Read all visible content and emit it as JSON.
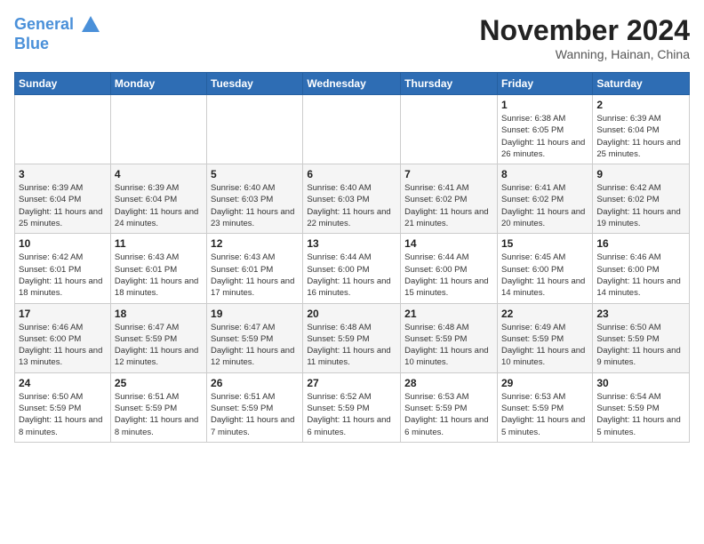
{
  "logo": {
    "line1": "General",
    "line2": "Blue"
  },
  "title": "November 2024",
  "subtitle": "Wanning, Hainan, China",
  "weekdays": [
    "Sunday",
    "Monday",
    "Tuesday",
    "Wednesday",
    "Thursday",
    "Friday",
    "Saturday"
  ],
  "weeks": [
    [
      {
        "day": "",
        "info": ""
      },
      {
        "day": "",
        "info": ""
      },
      {
        "day": "",
        "info": ""
      },
      {
        "day": "",
        "info": ""
      },
      {
        "day": "",
        "info": ""
      },
      {
        "day": "1",
        "info": "Sunrise: 6:38 AM\nSunset: 6:05 PM\nDaylight: 11 hours and 26 minutes."
      },
      {
        "day": "2",
        "info": "Sunrise: 6:39 AM\nSunset: 6:04 PM\nDaylight: 11 hours and 25 minutes."
      }
    ],
    [
      {
        "day": "3",
        "info": "Sunrise: 6:39 AM\nSunset: 6:04 PM\nDaylight: 11 hours and 25 minutes."
      },
      {
        "day": "4",
        "info": "Sunrise: 6:39 AM\nSunset: 6:04 PM\nDaylight: 11 hours and 24 minutes."
      },
      {
        "day": "5",
        "info": "Sunrise: 6:40 AM\nSunset: 6:03 PM\nDaylight: 11 hours and 23 minutes."
      },
      {
        "day": "6",
        "info": "Sunrise: 6:40 AM\nSunset: 6:03 PM\nDaylight: 11 hours and 22 minutes."
      },
      {
        "day": "7",
        "info": "Sunrise: 6:41 AM\nSunset: 6:02 PM\nDaylight: 11 hours and 21 minutes."
      },
      {
        "day": "8",
        "info": "Sunrise: 6:41 AM\nSunset: 6:02 PM\nDaylight: 11 hours and 20 minutes."
      },
      {
        "day": "9",
        "info": "Sunrise: 6:42 AM\nSunset: 6:02 PM\nDaylight: 11 hours and 19 minutes."
      }
    ],
    [
      {
        "day": "10",
        "info": "Sunrise: 6:42 AM\nSunset: 6:01 PM\nDaylight: 11 hours and 18 minutes."
      },
      {
        "day": "11",
        "info": "Sunrise: 6:43 AM\nSunset: 6:01 PM\nDaylight: 11 hours and 18 minutes."
      },
      {
        "day": "12",
        "info": "Sunrise: 6:43 AM\nSunset: 6:01 PM\nDaylight: 11 hours and 17 minutes."
      },
      {
        "day": "13",
        "info": "Sunrise: 6:44 AM\nSunset: 6:00 PM\nDaylight: 11 hours and 16 minutes."
      },
      {
        "day": "14",
        "info": "Sunrise: 6:44 AM\nSunset: 6:00 PM\nDaylight: 11 hours and 15 minutes."
      },
      {
        "day": "15",
        "info": "Sunrise: 6:45 AM\nSunset: 6:00 PM\nDaylight: 11 hours and 14 minutes."
      },
      {
        "day": "16",
        "info": "Sunrise: 6:46 AM\nSunset: 6:00 PM\nDaylight: 11 hours and 14 minutes."
      }
    ],
    [
      {
        "day": "17",
        "info": "Sunrise: 6:46 AM\nSunset: 6:00 PM\nDaylight: 11 hours and 13 minutes."
      },
      {
        "day": "18",
        "info": "Sunrise: 6:47 AM\nSunset: 5:59 PM\nDaylight: 11 hours and 12 minutes."
      },
      {
        "day": "19",
        "info": "Sunrise: 6:47 AM\nSunset: 5:59 PM\nDaylight: 11 hours and 12 minutes."
      },
      {
        "day": "20",
        "info": "Sunrise: 6:48 AM\nSunset: 5:59 PM\nDaylight: 11 hours and 11 minutes."
      },
      {
        "day": "21",
        "info": "Sunrise: 6:48 AM\nSunset: 5:59 PM\nDaylight: 11 hours and 10 minutes."
      },
      {
        "day": "22",
        "info": "Sunrise: 6:49 AM\nSunset: 5:59 PM\nDaylight: 11 hours and 10 minutes."
      },
      {
        "day": "23",
        "info": "Sunrise: 6:50 AM\nSunset: 5:59 PM\nDaylight: 11 hours and 9 minutes."
      }
    ],
    [
      {
        "day": "24",
        "info": "Sunrise: 6:50 AM\nSunset: 5:59 PM\nDaylight: 11 hours and 8 minutes."
      },
      {
        "day": "25",
        "info": "Sunrise: 6:51 AM\nSunset: 5:59 PM\nDaylight: 11 hours and 8 minutes."
      },
      {
        "day": "26",
        "info": "Sunrise: 6:51 AM\nSunset: 5:59 PM\nDaylight: 11 hours and 7 minutes."
      },
      {
        "day": "27",
        "info": "Sunrise: 6:52 AM\nSunset: 5:59 PM\nDaylight: 11 hours and 6 minutes."
      },
      {
        "day": "28",
        "info": "Sunrise: 6:53 AM\nSunset: 5:59 PM\nDaylight: 11 hours and 6 minutes."
      },
      {
        "day": "29",
        "info": "Sunrise: 6:53 AM\nSunset: 5:59 PM\nDaylight: 11 hours and 5 minutes."
      },
      {
        "day": "30",
        "info": "Sunrise: 6:54 AM\nSunset: 5:59 PM\nDaylight: 11 hours and 5 minutes."
      }
    ]
  ]
}
